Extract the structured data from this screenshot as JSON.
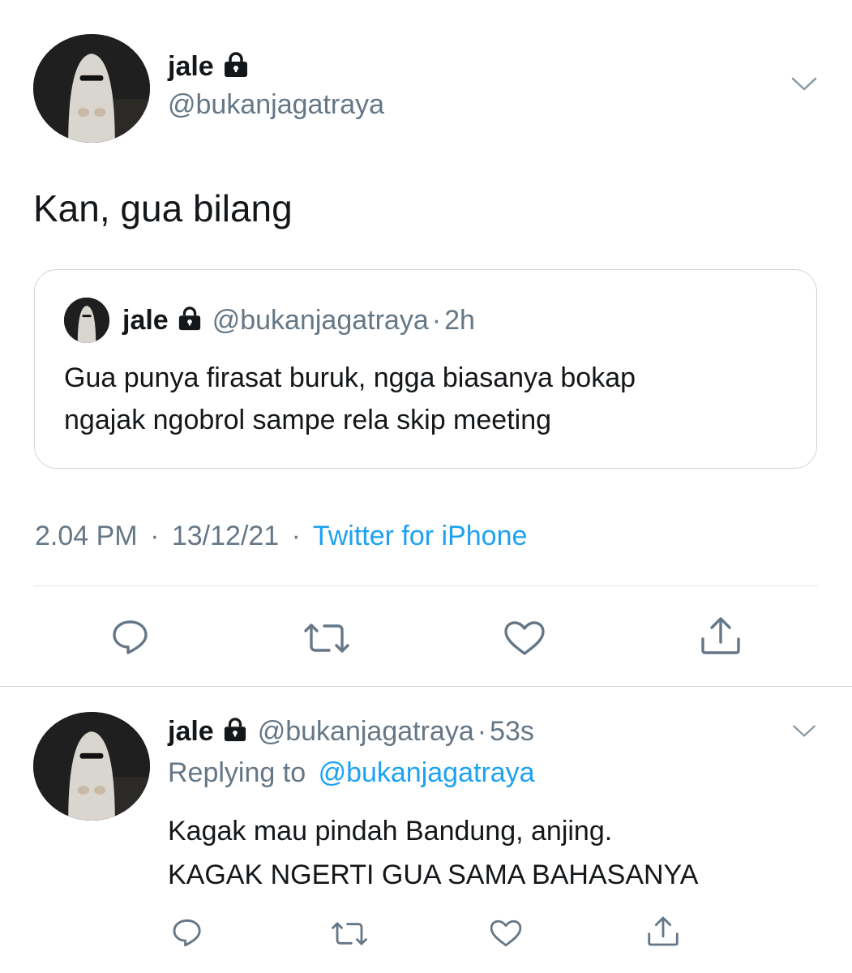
{
  "main_tweet": {
    "display_name": "jale",
    "handle": "@bukanjagatraya",
    "text": "Kan, gua bilang",
    "quoted": {
      "display_name": "jale",
      "handle": "@bukanjagatraya",
      "sep": "·",
      "time": "2h",
      "text_line1": "Gua punya firasat buruk, ngga biasanya bokap",
      "text_line2": "ngajak ngobrol sampe rela skip meeting"
    },
    "time": "2.04 PM",
    "sep1": "·",
    "date": "13/12/21",
    "sep2": "·",
    "source": "Twitter for iPhone"
  },
  "reply_tweet": {
    "display_name": "jale",
    "handle": "@bukanjagatraya",
    "sep": "·",
    "time": "53s",
    "replying_prefix": "Replying to",
    "replying_handle": "@bukanjagatraya",
    "text_line1": "Kagak mau pindah Bandung, anjing.",
    "text_line2": "KAGAK NGERTI GUA SAMA BAHASANYA"
  },
  "icons": {
    "lock": "lock-icon",
    "chevron": "chevron-down-icon",
    "reply": "reply-icon",
    "retweet": "retweet-icon",
    "like": "heart-icon",
    "share": "share-icon"
  },
  "colors": {
    "text": "#14171a",
    "muted": "#657786",
    "link": "#1da1f2",
    "icon": "#657786",
    "border": "#ccd6dd"
  }
}
